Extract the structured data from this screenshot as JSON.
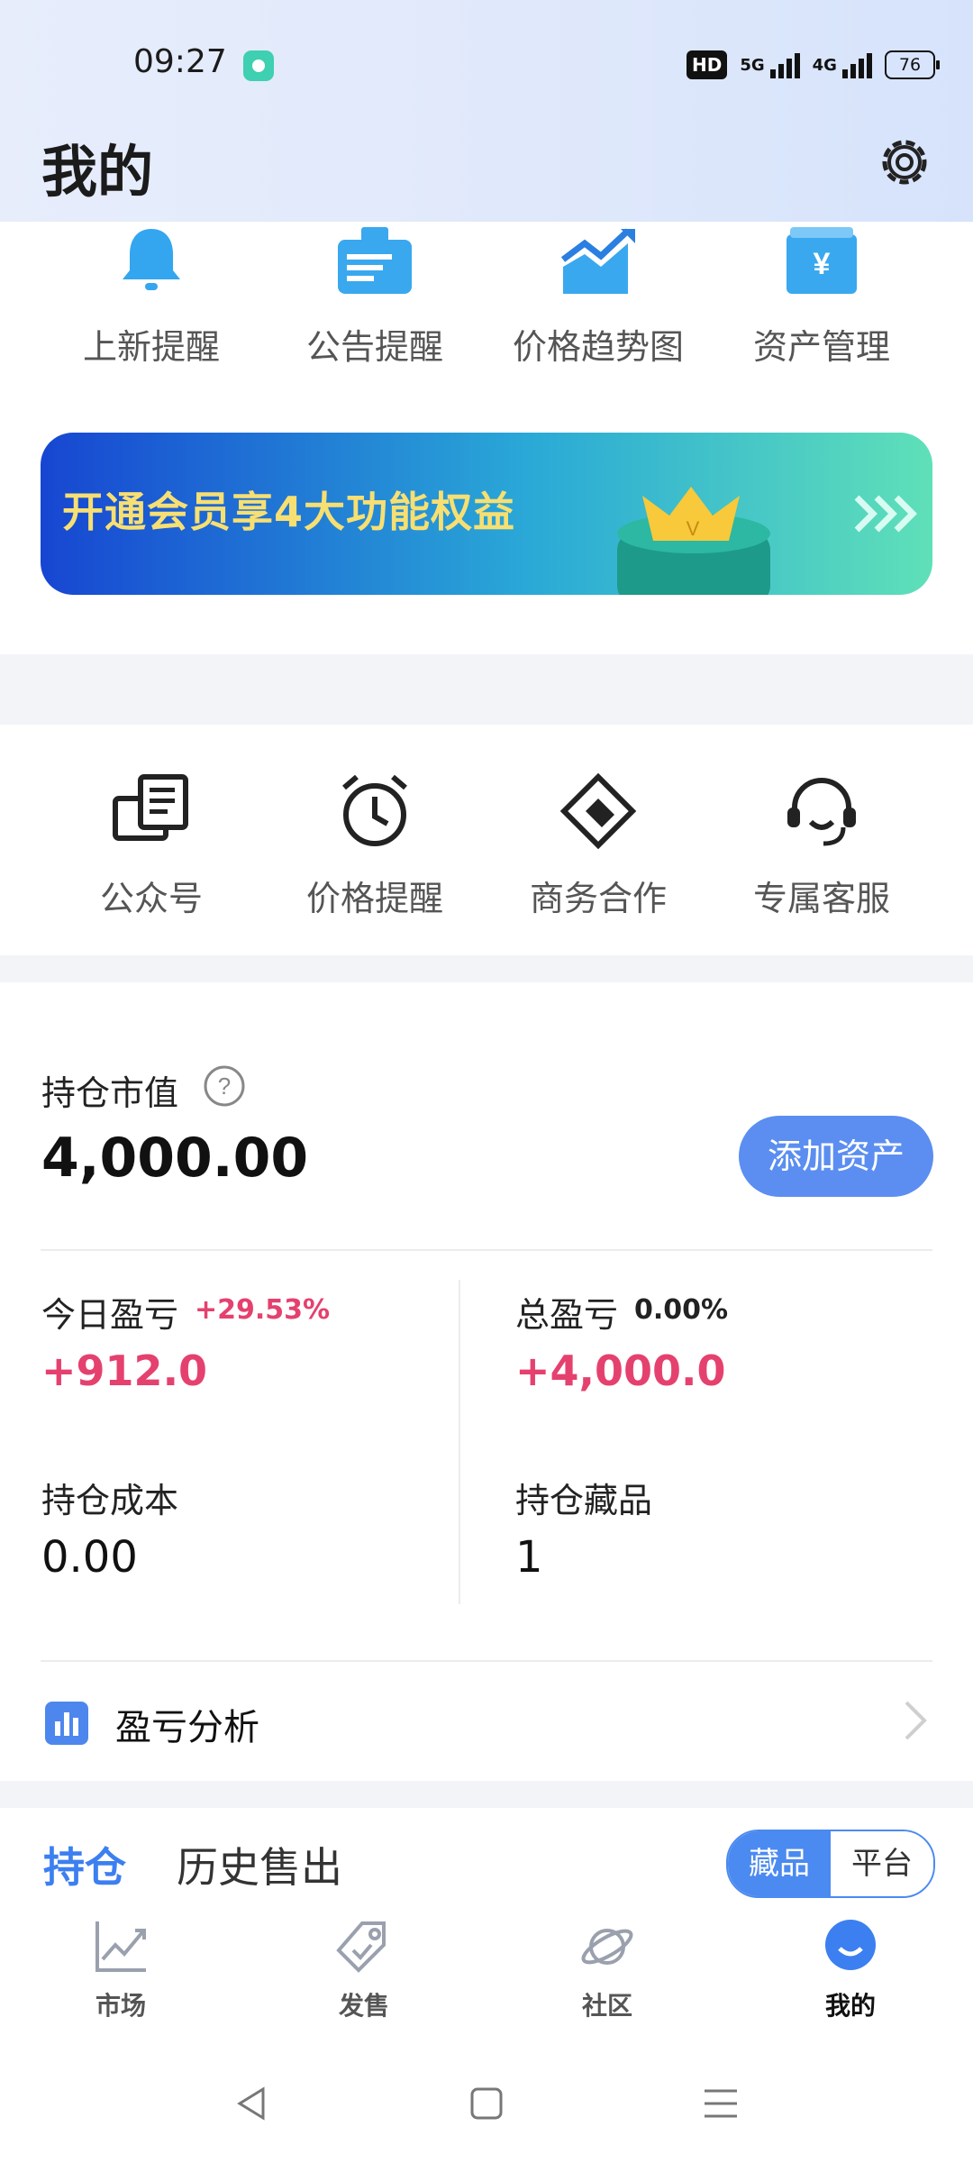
{
  "status_bar": {
    "time": "09:27",
    "network_hd": "HD",
    "network_5g": "5G",
    "network_4g": "4G",
    "battery": "76"
  },
  "header": {
    "title": "我的"
  },
  "quick_actions": [
    {
      "label": "上新提醒",
      "icon": "bell-icon"
    },
    {
      "label": "公告提醒",
      "icon": "announcement-icon"
    },
    {
      "label": "价格趋势图",
      "icon": "trend-chart-icon"
    },
    {
      "label": "资产管理",
      "icon": "wallet-yen-icon"
    }
  ],
  "banner": {
    "text": "开通会员享4大功能权益"
  },
  "tools": [
    {
      "label": "公众号",
      "icon": "official-account-icon"
    },
    {
      "label": "价格提醒",
      "icon": "alarm-clock-icon"
    },
    {
      "label": "商务合作",
      "icon": "handshake-icon"
    },
    {
      "label": "专属客服",
      "icon": "headset-icon"
    }
  ],
  "portfolio": {
    "market_value_label": "持仓市值",
    "market_value": "4,000.00",
    "add_asset_label": "添加资产",
    "today_pnl_label": "今日盈亏",
    "today_pnl_pct": "+29.53%",
    "today_pnl": "+912.0",
    "total_pnl_label": "总盈亏",
    "total_pnl_pct": "0.00%",
    "total_pnl": "+4,000.0",
    "cost_label": "持仓成本",
    "cost": "0.00",
    "items_label": "持仓藏品",
    "items": "1",
    "analysis_label": "盈亏分析"
  },
  "holdings_tabs": {
    "active": "持仓",
    "other": "历史售出",
    "seg_on": "藏品",
    "seg_off": "平台"
  },
  "bottom_nav": [
    {
      "label": "市场",
      "icon": "market-chart-icon"
    },
    {
      "label": "发售",
      "icon": "tag-icon"
    },
    {
      "label": "社区",
      "icon": "planet-icon"
    },
    {
      "label": "我的",
      "icon": "profile-icon"
    }
  ],
  "colors": {
    "accent": "#4b8af0",
    "profit": "#e5416e",
    "banner_text": "#f7df72"
  }
}
